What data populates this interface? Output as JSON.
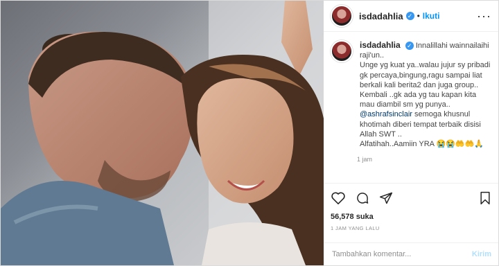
{
  "post": {
    "username": "isdadahlia",
    "follow_label": "Ikuti",
    "more_icon": "more-icon",
    "caption": {
      "lines": [
        "Innalillahi wainnailaihi raji'un..",
        "Unge yg kuat ya..walau jujur sy pribadi gk percaya,bingung,ragu sampai liat berkali kali berita2 dan juga group..",
        "Kembali ..gk ada yg tau kapan kita mau diambil sm yg punya..",
        "semoga khusnul khotimah diberi tempat terbaik disisi Allah SWT ..",
        "Alfatihah..Aamiin YRA 😭😭🤲🤲🙏"
      ],
      "mention": "@ashrafsinclair",
      "time": "1 jam"
    },
    "likes": "56,578 suka",
    "timestamp": "1 JAM YANG LALU",
    "comment_placeholder": "Tambahkan komentar...",
    "post_label": "Kirim",
    "colors": {
      "accent": "#0095f6",
      "verified": "#3897f0"
    }
  }
}
